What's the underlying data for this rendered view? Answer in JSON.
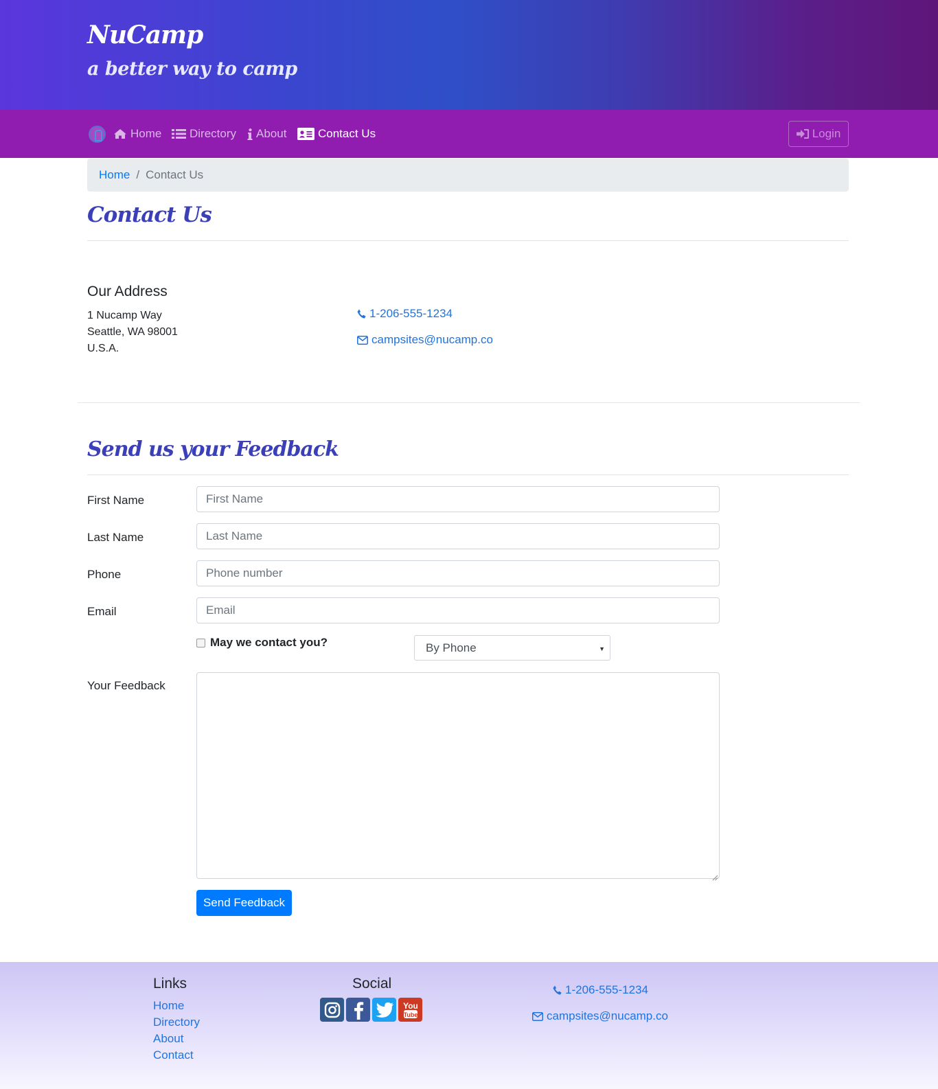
{
  "header": {
    "brand": "NuCamp",
    "tagline": "a better way to camp"
  },
  "nav": {
    "logo_icon": "nucamp-logo-icon",
    "items": [
      {
        "label": "Home",
        "icon": "home-icon"
      },
      {
        "label": "Directory",
        "icon": "list-icon"
      },
      {
        "label": "About",
        "icon": "info-icon"
      },
      {
        "label": "Contact Us",
        "icon": "address-card-icon",
        "active": true
      }
    ],
    "login_label": "Login",
    "login_icon": "sign-in-icon"
  },
  "breadcrumb": {
    "home": "Home",
    "separator": "/",
    "current": "Contact Us"
  },
  "page_title": "Contact Us",
  "address": {
    "title": "Our Address",
    "lines": [
      "1 Nucamp Way",
      "Seattle, WA 98001",
      "U.S.A."
    ],
    "phone": "1-206-555-1234",
    "email": "campsites@nucamp.co"
  },
  "feedback": {
    "title": "Send us your Feedback",
    "fields": {
      "first_name": {
        "label": "First Name",
        "placeholder": "First Name"
      },
      "last_name": {
        "label": "Last Name",
        "placeholder": "Last Name"
      },
      "phone": {
        "label": "Phone",
        "placeholder": "Phone number"
      },
      "email": {
        "label": "Email",
        "placeholder": "Email"
      }
    },
    "contact_checkbox_label": "May we contact you?",
    "contact_checked": false,
    "contact_method": "By Phone",
    "feedback_label": "Your Feedback",
    "submit_label": "Send Feedback"
  },
  "footer": {
    "links_title": "Links",
    "links": [
      "Home",
      "Directory",
      "About",
      "Contact"
    ],
    "social_title": "Social",
    "social_icons": [
      "instagram-icon",
      "facebook-icon",
      "twitter-icon",
      "youtube-icon"
    ],
    "phone": "1-206-555-1234",
    "email": "campsites@nucamp.co"
  },
  "colors": {
    "navbar": "#911cb0",
    "link": "#007bff",
    "heading": "#3b3fb8",
    "primary_button": "#007bff"
  }
}
